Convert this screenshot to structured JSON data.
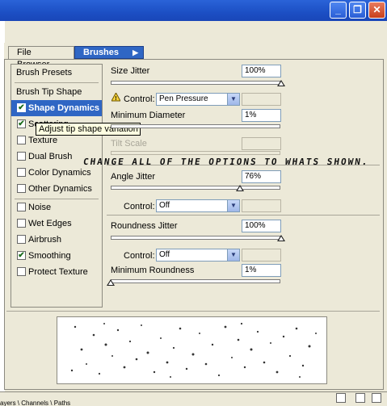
{
  "tabs": {
    "file_browser": "File Browser",
    "brushes": "Brushes"
  },
  "left_list": {
    "brush_presets": "Brush Presets",
    "brush_tip_shape": "Brush Tip Shape",
    "items": [
      {
        "label": "Shape Dynamics",
        "checked": true,
        "selected": true
      },
      {
        "label": "Scattering",
        "checked": true,
        "selected": false
      },
      {
        "label": "Texture",
        "checked": false,
        "selected": false
      },
      {
        "label": "Dual Brush",
        "checked": false,
        "selected": false
      },
      {
        "label": "Color Dynamics",
        "checked": false,
        "selected": false
      },
      {
        "label": "Other Dynamics",
        "checked": false,
        "selected": false
      },
      {
        "label": "Noise",
        "checked": false,
        "selected": false
      },
      {
        "label": "Wet Edges",
        "checked": false,
        "selected": false
      },
      {
        "label": "Airbrush",
        "checked": false,
        "selected": false
      },
      {
        "label": "Smoothing",
        "checked": true,
        "selected": false
      },
      {
        "label": "Protect Texture",
        "checked": false,
        "selected": false
      }
    ]
  },
  "tooltip": "Adjust tip shape variation",
  "size_jitter": {
    "label": "Size Jitter",
    "value": "100%"
  },
  "control1": {
    "label": "Control:",
    "value": "Pen Pressure"
  },
  "min_diameter": {
    "label": "Minimum Diameter",
    "value": "1%"
  },
  "tilt_scale": {
    "label": "Tilt Scale"
  },
  "overlay_text": "CHANGE ALL OF THE OPTIONS TO WHATS SHOWN.",
  "angle_jitter": {
    "label": "Angle Jitter",
    "value": "76%"
  },
  "control2": {
    "label": "Control:",
    "value": "Off"
  },
  "roundness_jitter": {
    "label": "Roundness Jitter",
    "value": "100%"
  },
  "control3": {
    "label": "Control:",
    "value": "Off"
  },
  "min_roundness": {
    "label": "Minimum Roundness",
    "value": "1%"
  },
  "window_buttons": {
    "minimize": "_",
    "restore": "❐",
    "close": "✕"
  },
  "layer_strip": "ayers \\ Channels \\ Paths"
}
